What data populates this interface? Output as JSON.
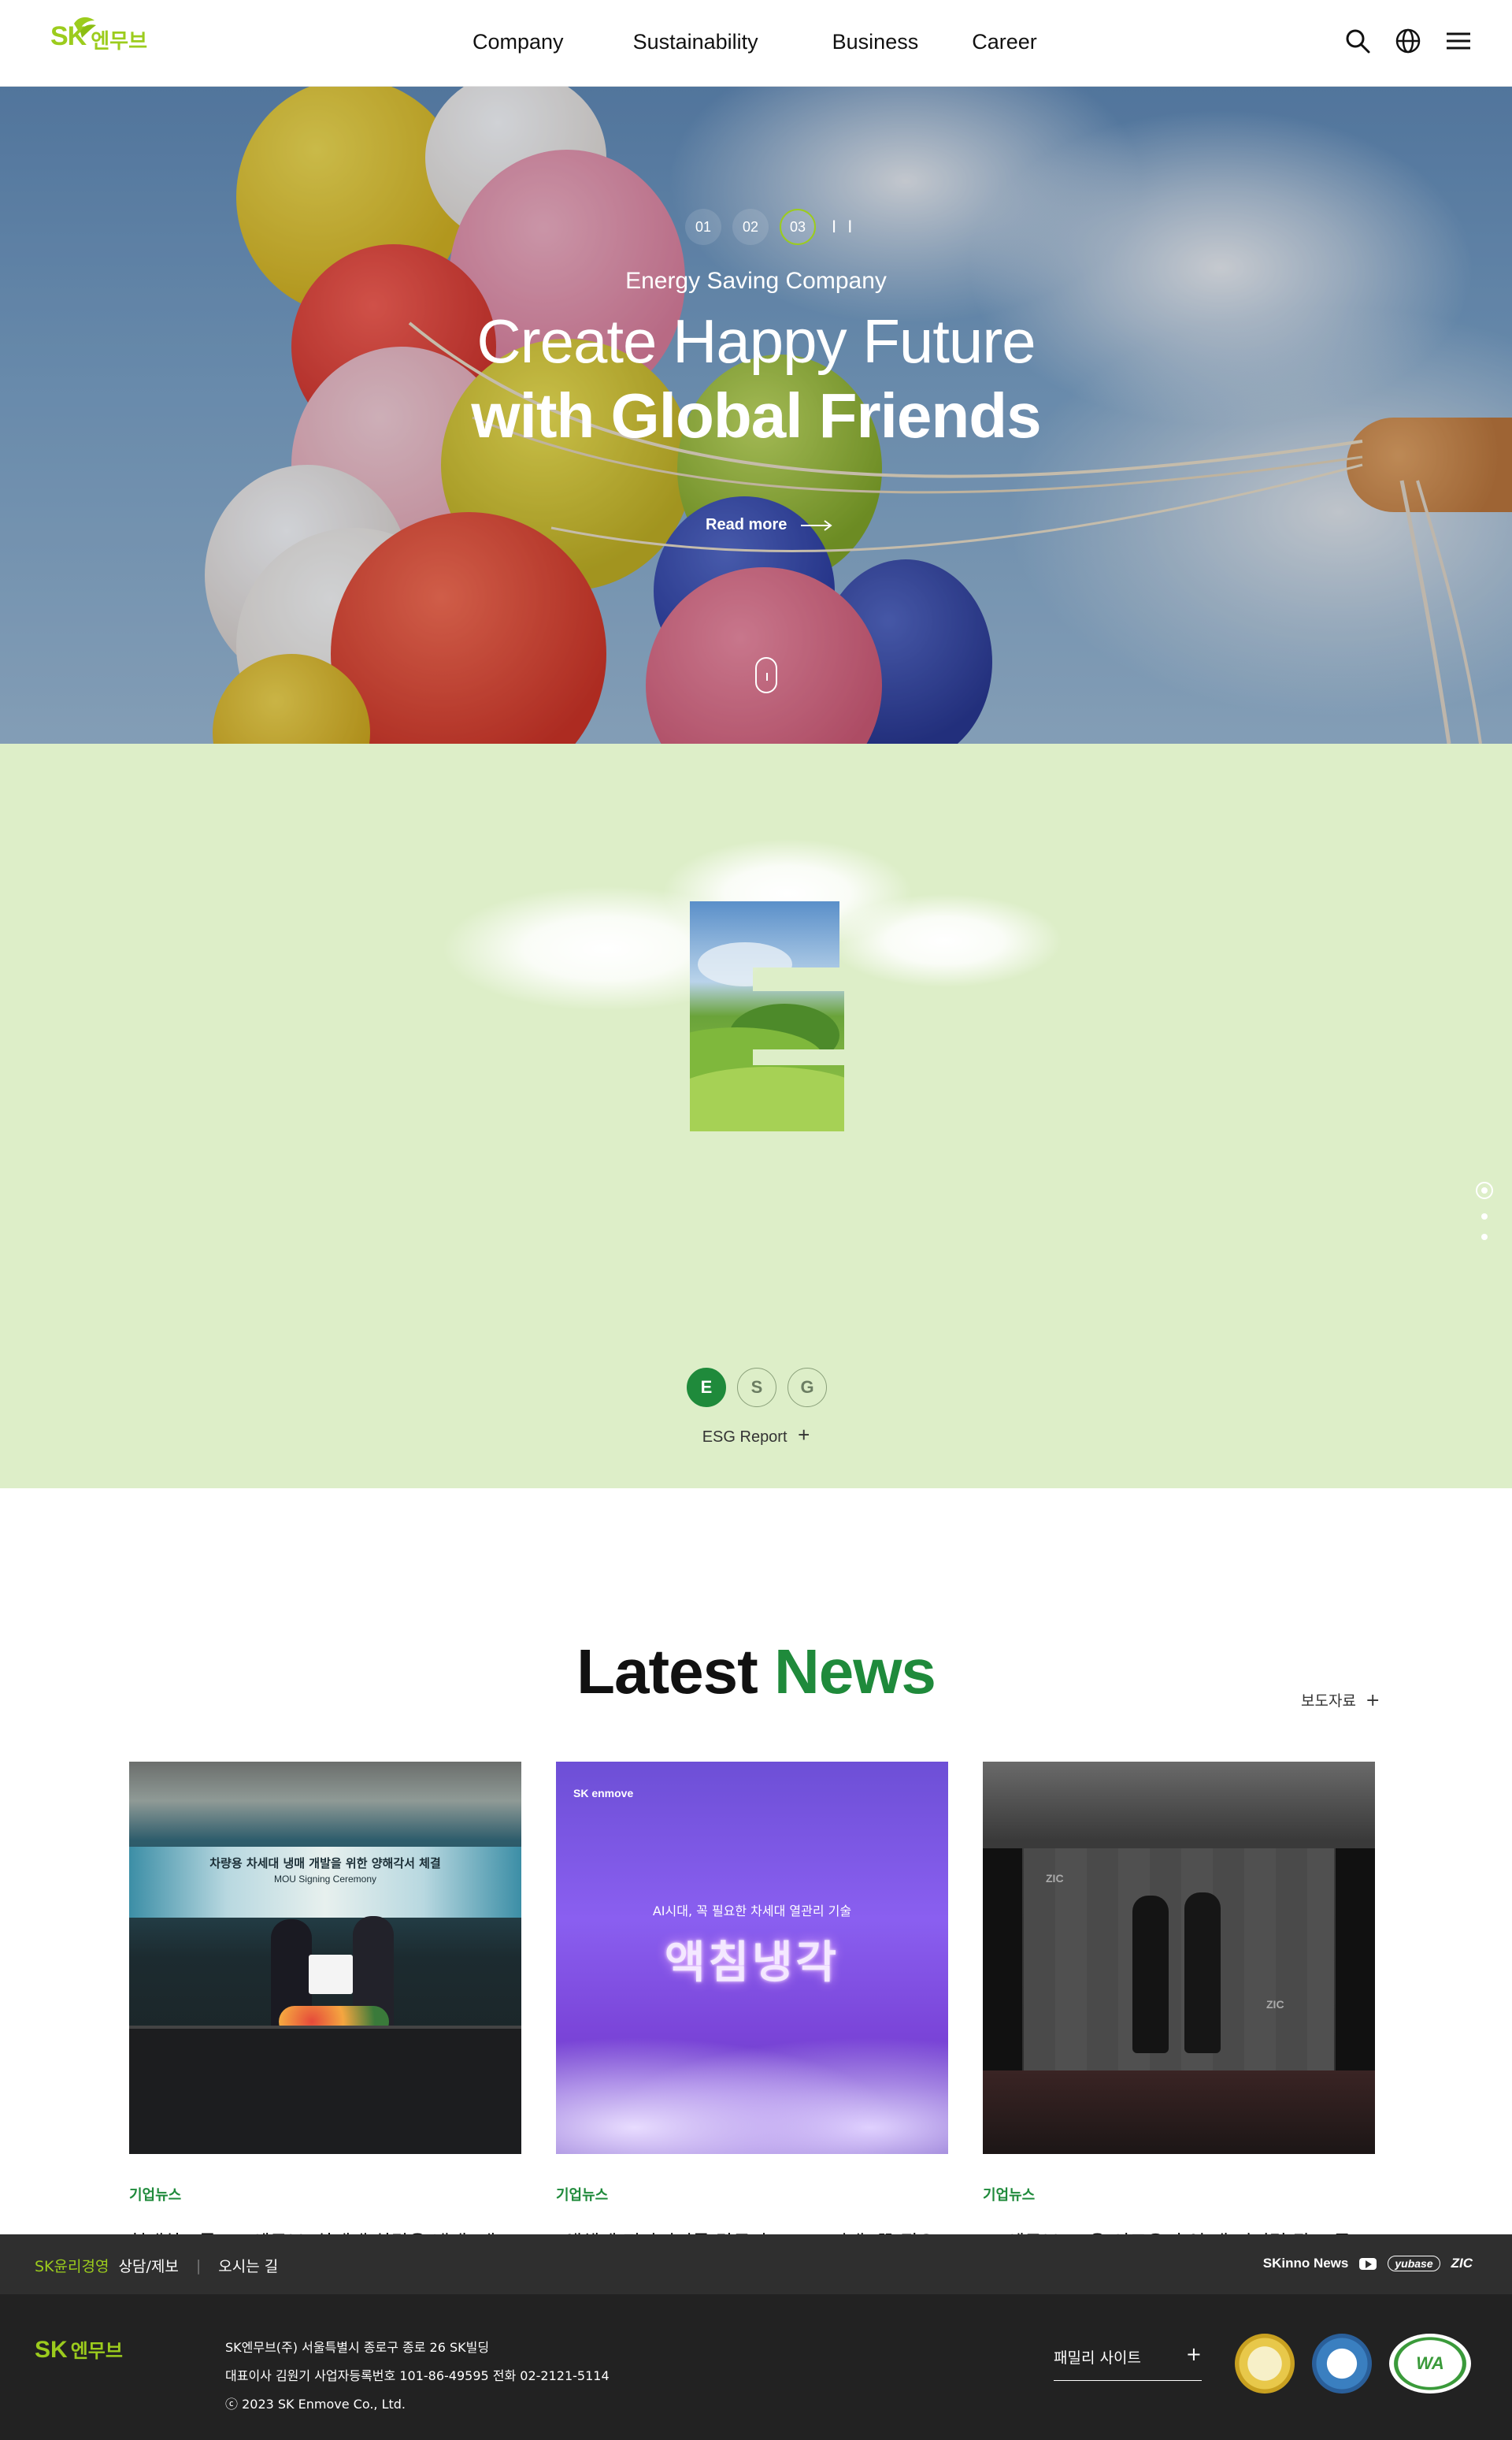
{
  "header": {
    "logo_sk": "SK",
    "logo_kr": "엔무브",
    "nav": [
      "Company",
      "Sustainability",
      "Business",
      "Career"
    ],
    "icons": [
      "search-icon",
      "globe-icon",
      "menu-icon"
    ]
  },
  "hero": {
    "slides": [
      "01",
      "02",
      "03"
    ],
    "active_slide": "03",
    "pause_label": "I I",
    "eyebrow": "Energy Saving Company",
    "headline_line1": "Create Happy Future",
    "headline_line2": "with Global Friends",
    "read_more": "Read more"
  },
  "esg": {
    "tabs": [
      "E",
      "S",
      "G"
    ],
    "active_tab": "E",
    "report_label": "ESG Report",
    "report_icon": "+"
  },
  "news": {
    "title_part1": "Latest",
    "title_part2": "News",
    "press_link": "보도자료",
    "press_icon": "+",
    "cards": [
      {
        "category": "기업뉴스",
        "title": "현대차그룹, SK엔무브 '차세대 차량용 냉매' 개",
        "banner_text": "차량용 차세대 냉매 개발을 위한 양해각서 체결",
        "banner_sub": "MOU Signing Ceremony"
      },
      {
        "category": "기업뉴스",
        "title": "\"액체에 전자기기를 담근다?\"… AI시대, 꼭 필요",
        "brand": "SK enmove",
        "overlay_small": "AI시대, 꼭 필요한 차세대 열관리 기술",
        "overlay_big": "액침냉각"
      },
      {
        "category": "기업뉴스",
        "title": "SK엔무브, 고윤·이도은 출연 새 디지털 광고 공",
        "wall_text": "ZIC"
      }
    ]
  },
  "footer_bar": {
    "ethics_green": "SK윤리경영",
    "ethics_white": "상담/제보",
    "directions": "오시는 길",
    "skinno": "SKinno News",
    "yubase": "yubase",
    "zic": "ZIC"
  },
  "footer": {
    "logo_sk": "SK",
    "logo_kr": "엔무브",
    "line1": "SK엔무브(주) 서울특별시 종로구 종로 26 SK빌딩",
    "line2": "대표이사 김원기 사업자등록번호 101-86-49595 전화 02-2121-5114",
    "line3": "ⓒ 2023 SK Enmove Co., Ltd.",
    "family_site": "패밀리 사이트",
    "family_icon": "+",
    "badge_wa": "WA"
  },
  "colors": {
    "brand_lime": "#9ccc1d",
    "brand_green": "#1f8a3b",
    "esg_bg": "#ddeec8",
    "footer_bg": "#222222"
  }
}
